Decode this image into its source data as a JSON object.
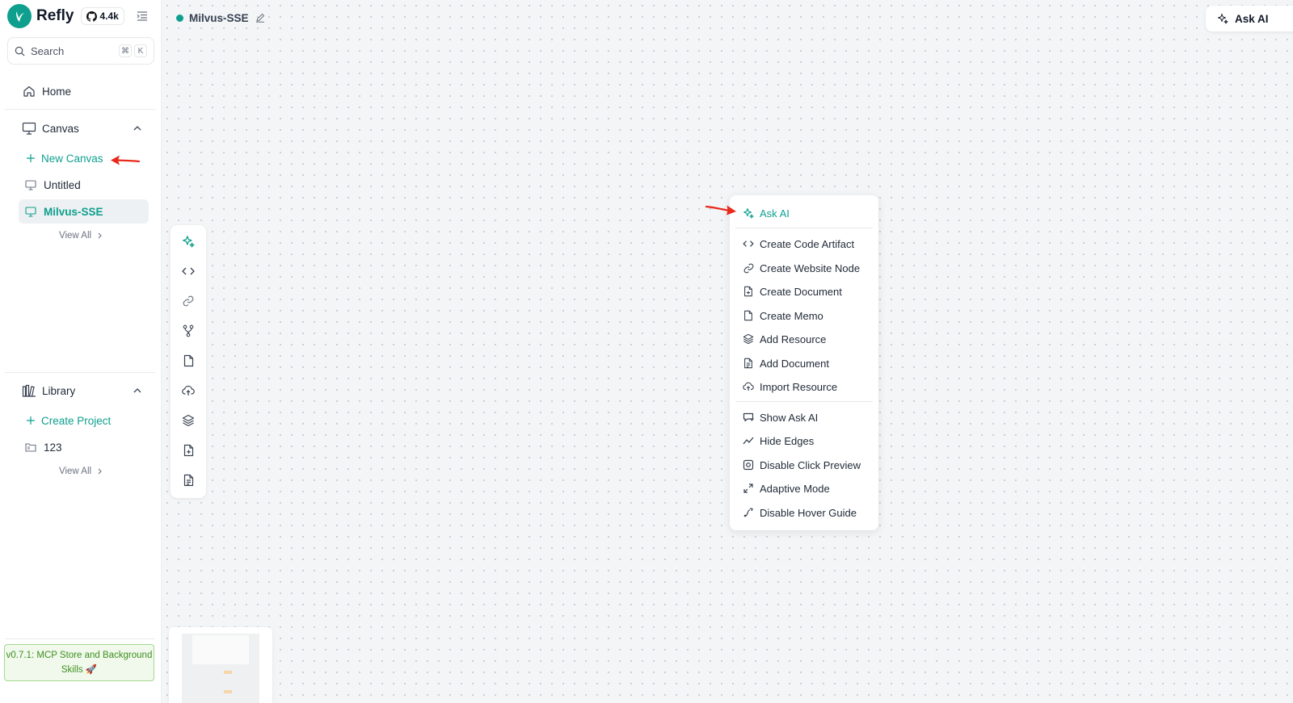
{
  "app": {
    "name": "Refly",
    "github_stars": "4.4k"
  },
  "search": {
    "placeholder": "Search",
    "shortcut_cmd": "⌘",
    "shortcut_key": "K"
  },
  "sidebar": {
    "home_label": "Home",
    "canvas": {
      "section_label": "Canvas",
      "new_label": "New Canvas",
      "items": [
        {
          "label": "Untitled"
        },
        {
          "label": "Milvus-SSE",
          "active": true
        }
      ],
      "view_all": "View All"
    },
    "library": {
      "section_label": "Library",
      "create_label": "Create Project",
      "items": [
        {
          "label": "123"
        }
      ],
      "view_all": "View All"
    },
    "release_note": "v0.7.1: MCP Store and Background Skills 🚀"
  },
  "canvas": {
    "title": "Milvus-SSE",
    "ask_ai_button": "Ask AI"
  },
  "toolbar": {
    "icons": [
      "sparkles-icon",
      "code-icon",
      "link-icon",
      "branch-icon",
      "file-icon",
      "cloud-upload-icon",
      "layers-icon",
      "file-plus-icon",
      "file-text-icon"
    ]
  },
  "context_menu": {
    "ask_ai": "Ask AI",
    "create_items": [
      "Create Code Artifact",
      "Create Website Node",
      "Create Document",
      "Create Memo",
      "Add Resource",
      "Add Document",
      "Import Resource"
    ],
    "view_items": [
      "Show Ask AI",
      "Hide Edges",
      "Disable Click Preview",
      "Adaptive Mode",
      "Disable Hover Guide"
    ]
  },
  "colors": {
    "accent": "#0e9f8e",
    "arrow": "#e8291c",
    "release_bg": "#f0f9ec",
    "release_text": "#3f8f1f"
  }
}
